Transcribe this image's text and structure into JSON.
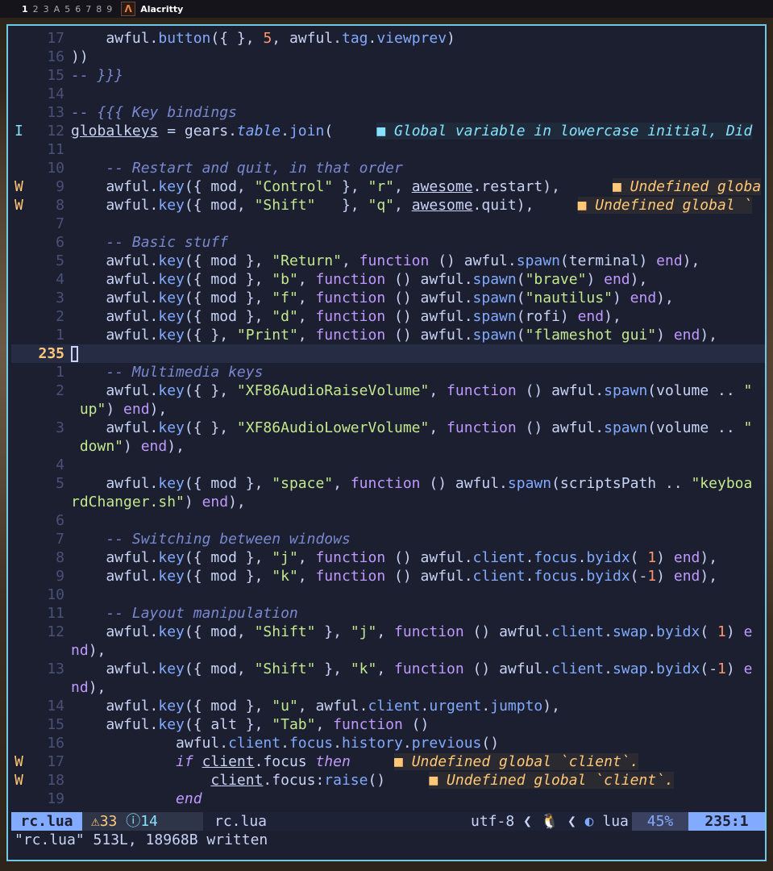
{
  "topbar": {
    "tags": [
      "1",
      "2",
      "3",
      "A",
      "5",
      "6",
      "7",
      "8",
      "9"
    ],
    "app_icon": "alacritty-icon",
    "app_title": "Alacritty"
  },
  "editor": {
    "lines": [
      {
        "sign": "",
        "num": "17",
        "html": "    awful.<span class=\"fn\">button</span>({ }, <span class=\"num\">5</span>, awful.<span class=\"fn\">tag</span>.<span class=\"fn\">viewprev</span>)"
      },
      {
        "sign": "",
        "num": "16",
        "html": "))"
      },
      {
        "sign": "",
        "num": "15",
        "html": "<span class=\"cm\">-- }}}</span>"
      },
      {
        "sign": "",
        "num": "14",
        "html": ""
      },
      {
        "sign": "",
        "num": "13",
        "html": "<span class=\"cm\">-- {{{ Key bindings</span>"
      },
      {
        "sign": "I",
        "num": "12",
        "html": "<span class=\"ul\">globalkeys</span> = gears.<span class=\"fn\" style=\"font-style:italic\">table</span>.<span class=\"fn\">join</span>(     <span class=\"diag-i\">■ Global variable in lowercase initial, Did</span>"
      },
      {
        "sign": "",
        "num": "11",
        "html": ""
      },
      {
        "sign": "",
        "num": "10",
        "html": "    <span class=\"cm\">-- Restart and quit, in that order</span>"
      },
      {
        "sign": "W",
        "num": "9",
        "html": "    awful.<span class=\"fn\">key</span>({ mod, <span class=\"str\">\"Control\"</span> }, <span class=\"str\">\"r\"</span>, <span class=\"ul\">awesome</span>.restart),      <span class=\"diag-w\">■ Undefined globa</span>"
      },
      {
        "sign": "W",
        "num": "8",
        "html": "    awful.<span class=\"fn\">key</span>({ mod, <span class=\"str\">\"Shift\"</span>   }, <span class=\"str\">\"q\"</span>, <span class=\"ul\">awesome</span>.quit),     <span class=\"diag-w\">■ Undefined global `</span>"
      },
      {
        "sign": "",
        "num": "7",
        "html": ""
      },
      {
        "sign": "",
        "num": "6",
        "html": "    <span class=\"cm\">-- Basic stuff</span>"
      },
      {
        "sign": "",
        "num": "5",
        "html": "    awful.<span class=\"fn\">key</span>({ mod }, <span class=\"str\">\"Return\"</span>, <span class=\"kw\">function</span> () awful.<span class=\"fn\">spawn</span>(terminal) <span class=\"kw\">end</span>),"
      },
      {
        "sign": "",
        "num": "4",
        "html": "    awful.<span class=\"fn\">key</span>({ mod }, <span class=\"str\">\"b\"</span>, <span class=\"kw\">function</span> () awful.<span class=\"fn\">spawn</span>(<span class=\"str\">\"brave\"</span>) <span class=\"kw\">end</span>),"
      },
      {
        "sign": "",
        "num": "3",
        "html": "    awful.<span class=\"fn\">key</span>({ mod }, <span class=\"str\">\"f\"</span>, <span class=\"kw\">function</span> () awful.<span class=\"fn\">spawn</span>(<span class=\"str\">\"nautilus\"</span>) <span class=\"kw\">end</span>),"
      },
      {
        "sign": "",
        "num": "2",
        "html": "    awful.<span class=\"fn\">key</span>({ mod }, <span class=\"str\">\"d\"</span>, <span class=\"kw\">function</span> () awful.<span class=\"fn\">spawn</span>(rofi) <span class=\"kw\">end</span>),"
      },
      {
        "sign": "",
        "num": "1",
        "html": "    awful.<span class=\"fn\">key</span>({ }, <span class=\"str\">\"Print\"</span>, <span class=\"kw\">function</span> () awful.<span class=\"fn\">spawn</span>(<span class=\"str\">\"flameshot gui\"</span>) <span class=\"kw\">end</span>),"
      },
      {
        "sign": "",
        "num": "235",
        "cur": true,
        "html": "<span class=\"cursor\"></span>"
      },
      {
        "sign": "",
        "num": "1",
        "html": "    <span class=\"cm\">-- Multimedia keys</span>"
      },
      {
        "sign": "",
        "num": "2",
        "html": "    awful.<span class=\"fn\">key</span>({ }, <span class=\"str\">\"XF86AudioRaiseVolume\"</span>, <span class=\"kw\">function</span> () awful.<span class=\"fn\">spawn</span>(volume .. <span class=\"str\">\"</span>"
      },
      {
        "sign": "",
        "num": "",
        "html": "<span class=\"str\"> up\"</span>) <span class=\"kw\">end</span>),"
      },
      {
        "sign": "",
        "num": "3",
        "html": "    awful.<span class=\"fn\">key</span>({ }, <span class=\"str\">\"XF86AudioLowerVolume\"</span>, <span class=\"kw\">function</span> () awful.<span class=\"fn\">spawn</span>(volume .. <span class=\"str\">\"</span>"
      },
      {
        "sign": "",
        "num": "",
        "html": "<span class=\"str\"> down\"</span>) <span class=\"kw\">end</span>),"
      },
      {
        "sign": "",
        "num": "4",
        "html": ""
      },
      {
        "sign": "",
        "num": "5",
        "html": "    awful.<span class=\"fn\">key</span>({ mod }, <span class=\"str\">\"space\"</span>, <span class=\"kw\">function</span> () awful.<span class=\"fn\">spawn</span>(scriptsPath .. <span class=\"str\">\"keyboa</span>"
      },
      {
        "sign": "",
        "num": "",
        "html": "<span class=\"str\">rdChanger.sh\"</span>) <span class=\"kw\">end</span>),"
      },
      {
        "sign": "",
        "num": "6",
        "html": ""
      },
      {
        "sign": "",
        "num": "7",
        "html": "    <span class=\"cm\">-- Switching between windows</span>"
      },
      {
        "sign": "",
        "num": "8",
        "html": "    awful.<span class=\"fn\">key</span>({ mod }, <span class=\"str\">\"j\"</span>, <span class=\"kw\">function</span> () awful.<span class=\"fn\">client</span>.<span class=\"fn\">focus</span>.<span class=\"fn\">byidx</span>( <span class=\"num\">1</span>) <span class=\"kw\">end</span>),"
      },
      {
        "sign": "",
        "num": "9",
        "html": "    awful.<span class=\"fn\">key</span>({ mod }, <span class=\"str\">\"k\"</span>, <span class=\"kw\">function</span> () awful.<span class=\"fn\">client</span>.<span class=\"fn\">focus</span>.<span class=\"fn\">byidx</span>(-<span class=\"num\">1</span>) <span class=\"kw\">end</span>),"
      },
      {
        "sign": "",
        "num": "10",
        "html": ""
      },
      {
        "sign": "",
        "num": "11",
        "html": "    <span class=\"cm\">-- Layout manipulation</span>"
      },
      {
        "sign": "",
        "num": "12",
        "html": "    awful.<span class=\"fn\">key</span>({ mod, <span class=\"str\">\"Shift\"</span> }, <span class=\"str\">\"j\"</span>, <span class=\"kw\">function</span> () awful.<span class=\"fn\">client</span>.<span class=\"fn\">swap</span>.<span class=\"fn\">byidx</span>( <span class=\"num\">1</span>) <span class=\"kw\">e</span>"
      },
      {
        "sign": "",
        "num": "",
        "html": "<span class=\"kw\">nd</span>),"
      },
      {
        "sign": "",
        "num": "13",
        "html": "    awful.<span class=\"fn\">key</span>({ mod, <span class=\"str\">\"Shift\"</span> }, <span class=\"str\">\"k\"</span>, <span class=\"kw\">function</span> () awful.<span class=\"fn\">client</span>.<span class=\"fn\">swap</span>.<span class=\"fn\">byidx</span>(-<span class=\"num\">1</span>) <span class=\"kw\">e</span>"
      },
      {
        "sign": "",
        "num": "",
        "html": "<span class=\"kw\">nd</span>),"
      },
      {
        "sign": "",
        "num": "14",
        "html": "    awful.<span class=\"fn\">key</span>({ mod }, <span class=\"str\">\"u\"</span>, awful.<span class=\"fn\">client</span>.<span class=\"fn\">urgent</span>.<span class=\"fn\">jumpto</span>),"
      },
      {
        "sign": "",
        "num": "15",
        "html": "    awful.<span class=\"fn\">key</span>({ alt }, <span class=\"str\">\"Tab\"</span>, <span class=\"kw\">function</span> ()"
      },
      {
        "sign": "",
        "num": "16",
        "html": "            awful.<span class=\"fn\">client</span>.<span class=\"fn\">focus</span>.<span class=\"fn\">history</span>.<span class=\"fn\">previous</span>()"
      },
      {
        "sign": "W",
        "num": "17",
        "html": "            <span class=\"kwi\">if</span> <span class=\"ul\">client</span>.focus <span class=\"kwi\">then</span>     <span class=\"diag-w\">■ Undefined global `client`.</span>"
      },
      {
        "sign": "W",
        "num": "18",
        "html": "                <span class=\"ul\">client</span>.focus:<span class=\"fn\">raise</span>()     <span class=\"diag-w\">■ Undefined global `client`.</span>"
      },
      {
        "sign": "",
        "num": "19",
        "html": "            <span class=\"kwi\">end</span>"
      }
    ]
  },
  "statusline": {
    "mode_file": "rc.lua",
    "warnings": "33",
    "infos": "14",
    "filename": "rc.lua",
    "encoding": "utf-8",
    "filetype": "lua",
    "percent": "45%",
    "position": "235:1"
  },
  "message": "\"rc.lua\" 513L, 18968B written"
}
